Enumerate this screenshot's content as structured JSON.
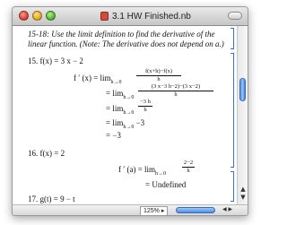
{
  "window": {
    "title": "3.1 HW Finished.nb",
    "zoom": "125%"
  },
  "notebook": {
    "instructions_line1": "15-18: Use the limit definition to find the derivative of the",
    "instructions_line2": "linear function. (Note: The derivative does not depend on a.)",
    "p15": {
      "label": "15. f(x) = 3 x − 2",
      "line1_lhs": "f ′ (x) = lim",
      "line1_sub": "h→0",
      "line1_num": "f(x+h)−f(x)",
      "line1_den": "h",
      "line2_lhs": "= lim",
      "line2_sub": "h→0",
      "line2_num": "(3 x−3 h−2)−(3 x−2)",
      "line2_den": "h",
      "line3_lhs": "= lim",
      "line3_sub": "h→0",
      "line3_num": "−3 h",
      "line3_den": "h",
      "line4_lhs": "= lim",
      "line4_sub": "h→0",
      "line4_rest": " −3",
      "line5": "= −3"
    },
    "p16": {
      "label": "16. f(x) = 2",
      "line1_lhs": "f ′ (a) = lim",
      "line1_sub": "h→0",
      "line1_num": "2−2",
      "line1_den": "h",
      "line2": "= Undefined"
    },
    "p17": {
      "label": "17. g(t) = 9 − t"
    }
  },
  "icons": {
    "scroll_up": "▲",
    "scroll_down": "▼",
    "h_arrows": "◀ ▶",
    "resize": "◢"
  },
  "colors": {
    "cell_bracket": "#3a6fd8",
    "scroll_thumb": "#4e8ee6"
  }
}
